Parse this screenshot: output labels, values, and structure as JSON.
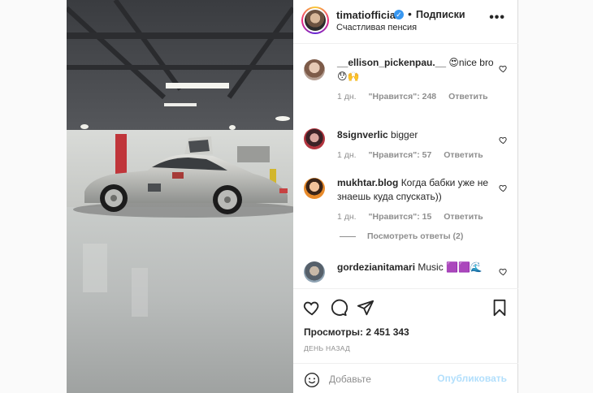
{
  "post": {
    "username": "timatiofficial",
    "verified_glyph": "✓",
    "separator": "•",
    "follow_state": "Подписки",
    "location": "Счастливая пенсия",
    "more_glyph": "•••",
    "media_icon": "video-garage-car"
  },
  "comments": [
    {
      "username": "__ellison_pickenpau.__",
      "text": "😍nice bro 😯🙌",
      "age": "1 дн.",
      "likes": "\"Нравится\": 248",
      "reply": "Ответить"
    },
    {
      "username": "8signverlic",
      "text": "bigger",
      "age": "1 дн.",
      "likes": "\"Нравится\": 57",
      "reply": "Ответить"
    },
    {
      "username": "mukhtar.blog",
      "text": "Когда бабки уже не знаешь куда спускать))",
      "age": "1 дн.",
      "likes": "\"Нравится\": 15",
      "reply": "Ответить"
    },
    {
      "username": "gordezianitamari",
      "text": "Music 🟪🟪🌊"
    }
  ],
  "view_replies": "Посмотреть ответы (2)",
  "stats": {
    "views": "Просмотры: 2 451 343",
    "time_ago": "ДЕНЬ НАЗАД"
  },
  "composer": {
    "placeholder": "Добавьте",
    "publish_label": "Опубликовать"
  },
  "colors": {
    "link_disabled": "#b2dffc",
    "verified": "#3897f0",
    "muted": "#8e8e8e"
  }
}
